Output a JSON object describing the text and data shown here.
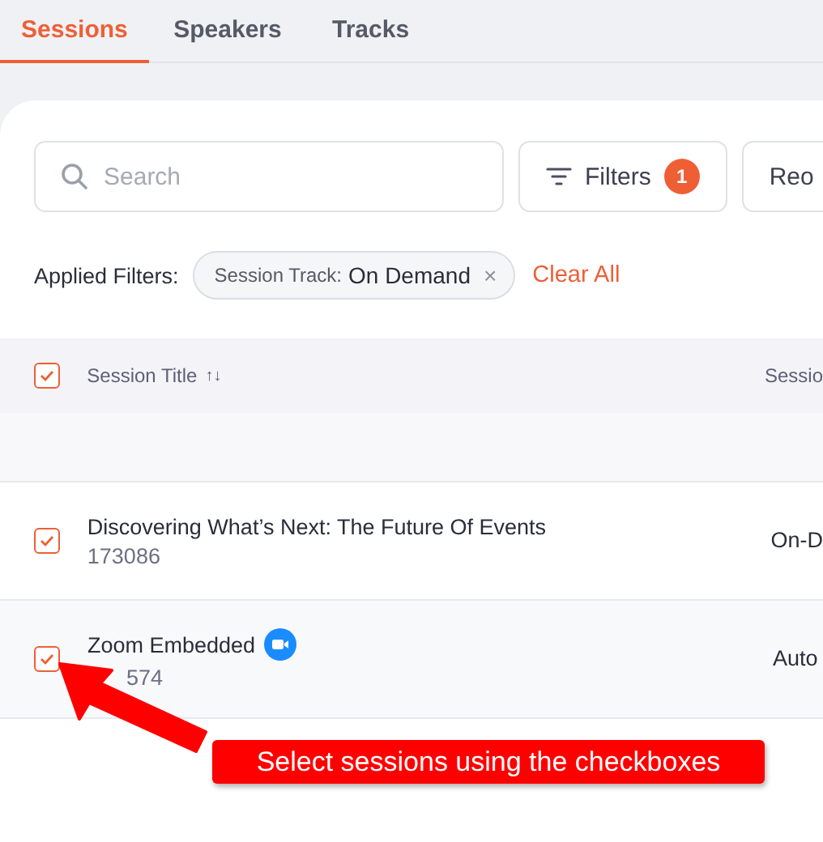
{
  "tabs": [
    {
      "label": "Sessions",
      "selected": true
    },
    {
      "label": "Speakers",
      "selected": false
    },
    {
      "label": "Tracks",
      "selected": false
    }
  ],
  "search": {
    "placeholder": "Search"
  },
  "filters_button": {
    "label": "Filters",
    "count": "1"
  },
  "cut_button": {
    "label": "Reo"
  },
  "applied_filters": {
    "label": "Applied Filters:",
    "chips": [
      {
        "key": "Session Track:",
        "value": "On Demand",
        "remove": "×"
      }
    ],
    "clear": "Clear All"
  },
  "table": {
    "header_checked": true,
    "columns": [
      "Session Title",
      "Sessio"
    ],
    "sort_icon": "↑↓",
    "rows": [
      {
        "checked": true,
        "title": "Discovering What’s Next: The Future Of Events",
        "id": "173086",
        "zoom": false,
        "column_2": "On-D"
      },
      {
        "checked": true,
        "title": "Zoom Embedded",
        "id": "574",
        "zoom": true,
        "column_2": "Auto"
      }
    ]
  },
  "callout": {
    "text": "Select sessions using the checkboxes"
  }
}
